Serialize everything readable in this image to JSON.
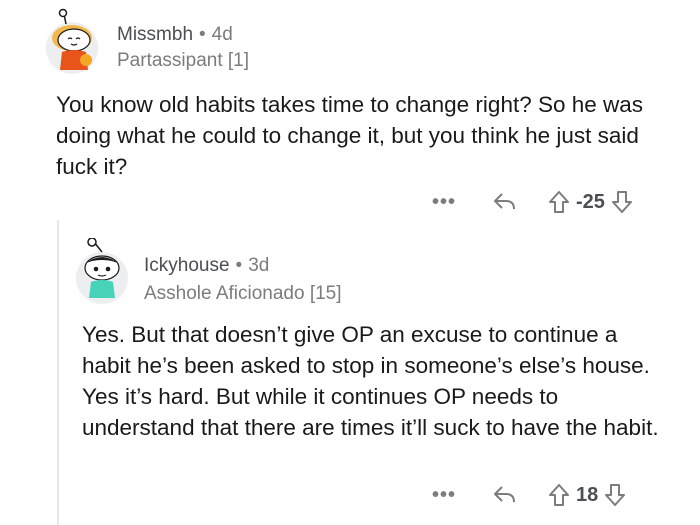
{
  "comments": [
    {
      "author": "Missmbh",
      "age": "4d",
      "flair": "Partassipant [1]",
      "body": "You know old habits takes time to change right? So he was doing what he could to change it, but you think he just said fuck it?",
      "more": "•••",
      "score": "-25",
      "icons": {
        "reply": "reply-arrow-icon",
        "upvote": "upvote-arrow-icon",
        "downvote": "downvote-arrow-icon"
      }
    },
    {
      "author": "Ickyhouse",
      "age": "3d",
      "flair": "Asshole Aficionado [15]",
      "body": "Yes. But that doesn’t give OP an excuse to continue a habit he’s been asked to stop in someone’s else’s house. Yes it’s hard. But while it continues OP needs to understand that there are times it’ll suck to have the habit.",
      "more": "•••",
      "score": "18",
      "icons": {
        "reply": "reply-arrow-icon",
        "upvote": "upvote-arrow-icon",
        "downvote": "downvote-arrow-icon"
      }
    }
  ],
  "colors": {
    "text": "#1a1a1b",
    "meta": "#7c7c7c",
    "thread_line": "#e6e6e6"
  }
}
